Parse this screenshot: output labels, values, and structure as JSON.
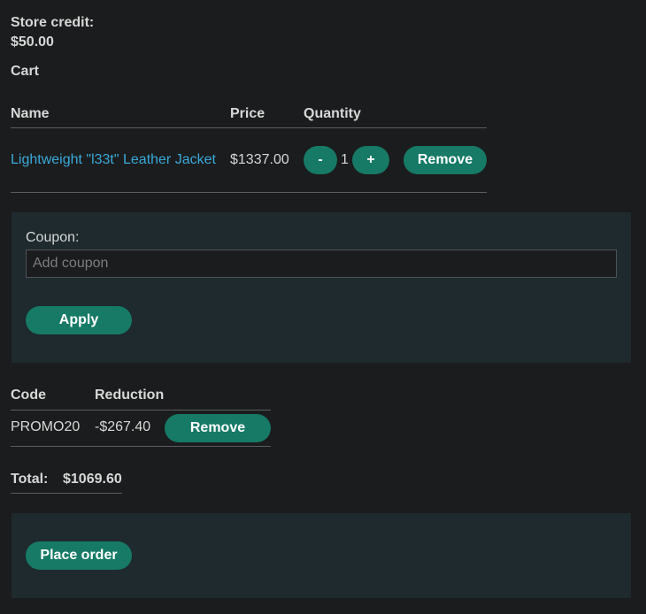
{
  "store_credit": {
    "label": "Store credit:",
    "value": "$50.00"
  },
  "cart": {
    "heading": "Cart",
    "columns": {
      "name": "Name",
      "price": "Price",
      "quantity": "Quantity"
    },
    "items": [
      {
        "name": "Lightweight \"l33t\" Leather Jacket",
        "price": "$1337.00",
        "quantity": "1",
        "decrement_label": "-",
        "increment_label": "+",
        "remove_label": "Remove"
      }
    ]
  },
  "coupon_form": {
    "label": "Coupon:",
    "placeholder": "Add coupon",
    "value": "",
    "apply_label": "Apply"
  },
  "coupons": {
    "columns": {
      "code": "Code",
      "reduction": "Reduction"
    },
    "rows": [
      {
        "code": "PROMO20",
        "reduction": "-$267.40",
        "remove_label": "Remove"
      }
    ]
  },
  "total": {
    "label": "Total:",
    "value": "$1069.60"
  },
  "order": {
    "place_label": "Place order"
  },
  "colors": {
    "background": "#1b1c1d",
    "panel": "#1e2a2e",
    "button": "#167a66",
    "link": "#39a9d9",
    "text": "#d7d7d7"
  }
}
